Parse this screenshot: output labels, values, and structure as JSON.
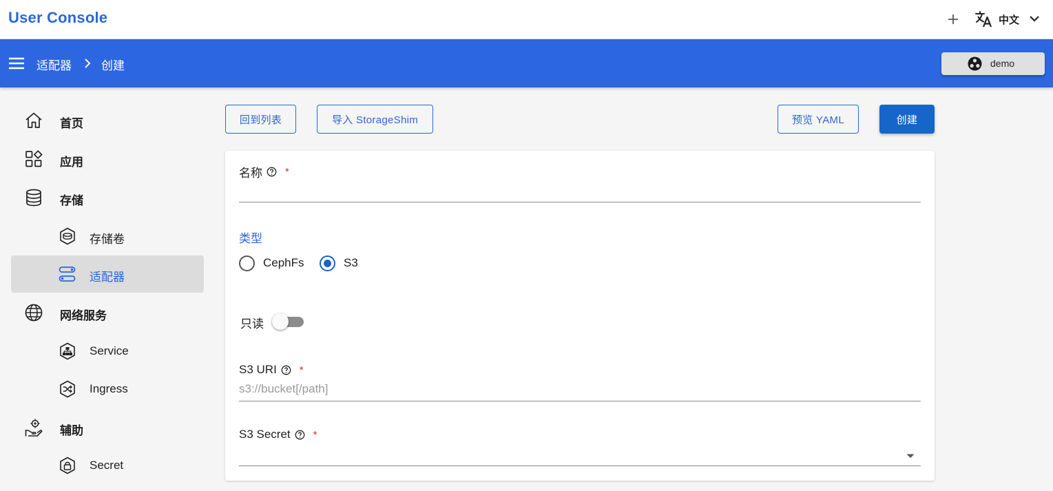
{
  "app": {
    "title": "User Console",
    "language": "中文",
    "icons": {
      "add": "plus-icon",
      "translate": "translate-icon",
      "language_menu": "chevron-down-icon"
    }
  },
  "navbar": {
    "breadcrumb": [
      "适配器",
      "创建"
    ],
    "namespace": "demo",
    "icons": {
      "menu": "menu-icon",
      "separator": "chevron-right-icon",
      "namespace": "namespace-icon"
    },
    "color": "#2c66e0"
  },
  "sidebar": {
    "items": [
      {
        "label": "首页",
        "icon": "home-icon",
        "level": 1
      },
      {
        "label": "应用",
        "icon": "apps-icon",
        "level": 1
      },
      {
        "label": "存储",
        "icon": "database-icon",
        "level": 1
      },
      {
        "label": "存储卷",
        "icon": "volume-icon",
        "level": 2
      },
      {
        "label": "适配器",
        "icon": "adapter-icon",
        "level": 2,
        "active": true
      },
      {
        "label": "网络服务",
        "icon": "globe-icon",
        "level": 1
      },
      {
        "label": "Service",
        "icon": "service-icon",
        "level": 2
      },
      {
        "label": "Ingress",
        "icon": "ingress-icon",
        "level": 2
      },
      {
        "label": "辅助",
        "icon": "helper-icon",
        "level": 1
      },
      {
        "label": "Secret",
        "icon": "lock-icon",
        "level": 2
      }
    ]
  },
  "toolbar": {
    "back_label": "回到列表",
    "import_label": "导入 StorageShim",
    "preview_label": "预览 YAML",
    "create_label": "创建"
  },
  "form": {
    "name": {
      "label": "名称",
      "required_mark": "*",
      "value": ""
    },
    "type": {
      "label": "类型",
      "options": [
        "CephFs",
        "S3"
      ],
      "selected": "S3"
    },
    "readonly": {
      "label": "只读",
      "checked": false
    },
    "s3_uri": {
      "label": "S3 URI",
      "required_mark": "*",
      "placeholder": "s3://bucket[/path]",
      "value": ""
    },
    "s3_secret": {
      "label": "S3 Secret",
      "required_mark": "*",
      "value": ""
    }
  }
}
